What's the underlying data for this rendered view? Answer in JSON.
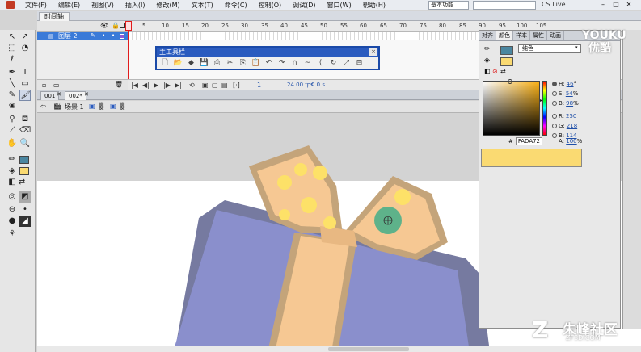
{
  "menu": {
    "items": [
      "文件(F)",
      "编辑(E)",
      "视图(V)",
      "插入(I)",
      "修改(M)",
      "文本(T)",
      "命令(C)",
      "控制(O)",
      "调试(D)",
      "窗口(W)",
      "帮助(H)"
    ],
    "workspace": "基本功能",
    "cs_live": "CS Live"
  },
  "timeline": {
    "tab_label": "时间轴",
    "layer_name": "图层 2",
    "frame_numbers": [
      "5",
      "10",
      "15",
      "20",
      "25",
      "30",
      "35",
      "40",
      "45",
      "50",
      "55",
      "60",
      "65",
      "70",
      "75",
      "80",
      "85",
      "90",
      "95",
      "100",
      "105"
    ],
    "current_frame": "1",
    "fps": "24.00 fps",
    "time": "0.0 s"
  },
  "main_toolbar": {
    "title": "主工具栏",
    "close": "×"
  },
  "documents": {
    "tabs": [
      "001",
      "002*"
    ],
    "scene": "场景 1"
  },
  "color_panel": {
    "tabs": [
      "对齐",
      "颜色",
      "样本",
      "属性",
      "动画"
    ],
    "active_tab": "颜色",
    "fill_type": "纯色",
    "stroke_color": "#4a86a0",
    "fill_color": "#fada72",
    "hsb": [
      {
        "label": "H:",
        "value": "46",
        "unit": "°"
      },
      {
        "label": "S:",
        "value": "54",
        "unit": "%"
      },
      {
        "label": "B:",
        "value": "98",
        "unit": "%"
      }
    ],
    "rgb": [
      {
        "label": "R:",
        "value": "250"
      },
      {
        "label": "G:",
        "value": "218"
      },
      {
        "label": "B:",
        "value": "114"
      }
    ],
    "hex": "FADA72",
    "alpha_label": "A:",
    "alpha_value": "100",
    "alpha_unit": "%"
  },
  "watermarks": {
    "youku_line1": "YOUKU",
    "youku_line2": "优酷",
    "zf_text": "朱峰社区",
    "zf_sub": "ZF3D.COM",
    "zf_logo": "Z"
  },
  "colors": {
    "box": "#8a8fcc",
    "box_shadow": "#767aa0",
    "ribbon": "#f6c893",
    "ribbon_outline": "#c4a47a",
    "dots": "#fde168",
    "handle": "#5eb28a"
  },
  "icons": {
    "arrow": "arrow-icon",
    "subselect": "subselect-icon",
    "free_transform": "free-transform-icon",
    "lasso": "lasso-icon",
    "pen": "pen-icon",
    "text": "text-icon",
    "line": "line-icon",
    "rect": "rectangle-icon",
    "pencil": "pencil-icon",
    "brush": "brush-icon",
    "bone": "bone-icon",
    "bucket": "paint-bucket-icon",
    "eyedropper": "eyedropper-icon",
    "eraser": "eraser-icon",
    "hand": "hand-icon",
    "zoom": "zoom-icon"
  }
}
